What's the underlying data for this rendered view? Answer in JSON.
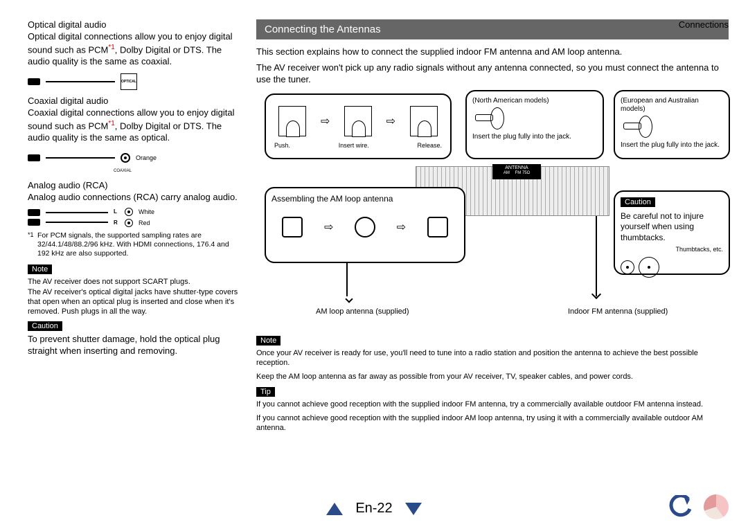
{
  "header": {
    "section": "Connections"
  },
  "left": {
    "optical": {
      "title": "Optical digital audio",
      "body_a": "Optical digital connections allow you to enjoy digital sound such as PCM",
      "sup": "*1",
      "body_b": ", Dolby Digital or DTS. The audio quality is the same as coaxial.",
      "connector_label": "OPTICAL"
    },
    "coaxial": {
      "title": "Coaxial digital audio",
      "body_a": "Coaxial digital connections allow you to enjoy digital sound such as PCM",
      "sup": "*1",
      "body_b": ", Dolby Digital or DTS. The audio quality is the same as optical.",
      "color": "Orange",
      "connector_label": "COAXIAL"
    },
    "analog": {
      "title": "Analog audio (RCA)",
      "body": "Analog audio connections (RCA) carry analog audio.",
      "l": "L",
      "white": "White",
      "r": "R",
      "red": "Red"
    },
    "footnote": {
      "mark": "*1",
      "text": "For PCM signals, the supported sampling rates are 32/44.1/48/88.2/96 kHz. With HDMI connections, 176.4 and 192 kHz are also supported."
    },
    "note_label": "Note",
    "note_text": "The AV receiver does not support SCART plugs.\nThe AV receiver's optical digital jacks have shutter-type covers that open when an optical plug is inserted and close when it's removed. Push plugs in all the way.",
    "caution_label": "Caution",
    "caution_text": "To prevent shutter damage, hold the optical plug straight when inserting and removing."
  },
  "right": {
    "banner": "Connecting the Antennas",
    "intro1": "This section explains how to connect the supplied indoor FM antenna and AM loop antenna.",
    "intro2": "The AV receiver won't pick up any radio signals without any antenna connected, so you must connect the antenna to use the tuner.",
    "box_top1": {
      "s1": "Push.",
      "s2": "Insert wire.",
      "s3": "Release."
    },
    "box_top2": {
      "title": "(North American models)",
      "insert": "Insert the plug fully into the jack."
    },
    "box_top3": {
      "title": "(European and Australian models)",
      "insert": "Insert the plug fully into the jack."
    },
    "panel": {
      "label": "ANTENNA",
      "am": "AM",
      "fm": "FM 75Ω"
    },
    "amloop": {
      "title": "Assembling the AM loop antenna"
    },
    "caution_box": {
      "label": "Caution",
      "text": "Be careful not to injure yourself when using thumbtacks.",
      "tt": "Thumbtacks, etc."
    },
    "callout_am": "AM loop antenna (supplied)",
    "callout_fm": "Indoor FM antenna (supplied)",
    "note_label": "Note",
    "note_text1": "Once your AV receiver is ready for use, you'll need to tune into a radio station and position the antenna to achieve the best possible reception.",
    "note_text2": "Keep the AM loop antenna as far away as possible from your AV receiver, TV, speaker cables, and power cords.",
    "tip_label": "Tip",
    "tip_text1": "If you cannot achieve good reception with the supplied indoor FM antenna, try a commercially available outdoor FM antenna instead.",
    "tip_text2": "If you cannot achieve good reception with the supplied indoor AM loop antenna, try using it with a commercially available outdoor AM antenna."
  },
  "footer": {
    "page": "En-22"
  }
}
